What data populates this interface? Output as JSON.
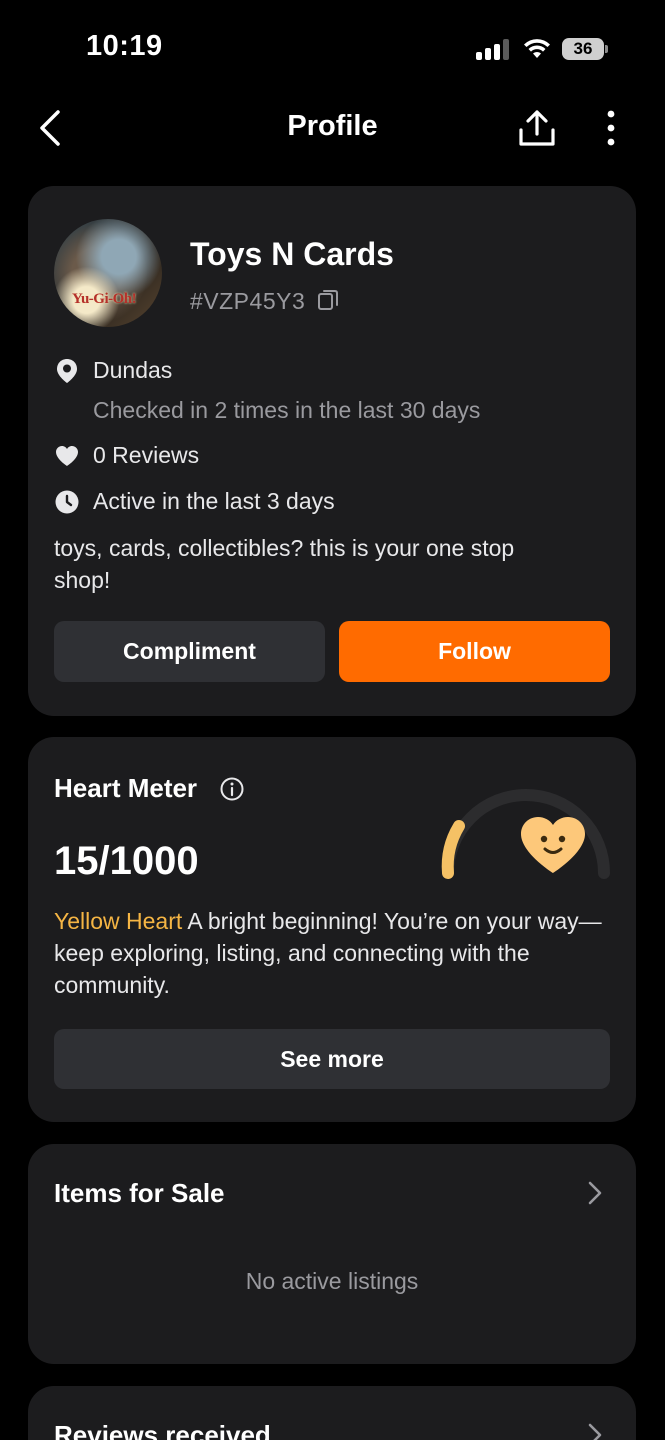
{
  "status": {
    "time": "10:19",
    "battery": "36"
  },
  "nav": {
    "title": "Profile"
  },
  "profile": {
    "avatar_text": "Yu-Gi-Oh!",
    "name": "Toys N Cards",
    "id": "#VZP45Y3",
    "location": "Dundas",
    "checkins": "Checked in 2 times in the last 30 days",
    "reviews": "0 Reviews",
    "activity": "Active in the last 3 days",
    "bio": "toys, cards, collectibles? this is your one stop shop!",
    "compliment_label": "Compliment",
    "follow_label": "Follow"
  },
  "heart_meter": {
    "title": "Heart Meter",
    "score": "15/1000",
    "progress": 0.015,
    "level": "Yellow Heart",
    "description": "A bright beginning! You’re on your way—keep exploring, listing, and connecting with the community.",
    "see_more_label": "See more"
  },
  "items_for_sale": {
    "title": "Items for Sale",
    "empty_text": "No active listings"
  },
  "reviews_received": {
    "title": "Reviews received"
  },
  "colors": {
    "accent": "#ff6b00",
    "heart_yellow": "#f5b544",
    "card_bg": "#1c1c1e",
    "button_bg": "#2f3034"
  },
  "icons": [
    "back-icon",
    "share-icon",
    "more-icon",
    "copy-icon",
    "location-pin-icon",
    "heart-icon",
    "clock-icon",
    "info-icon",
    "chevron-right-icon"
  ]
}
